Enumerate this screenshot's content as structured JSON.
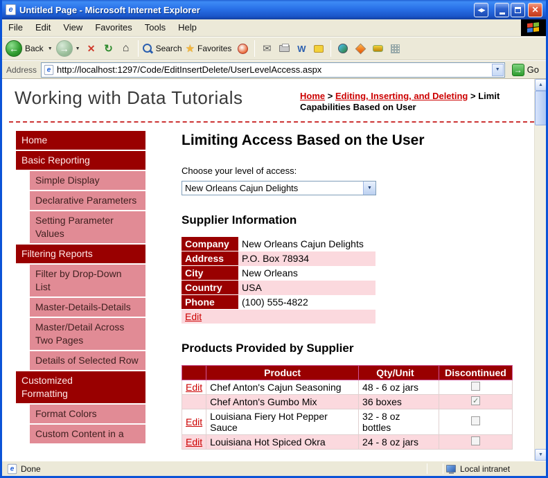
{
  "window": {
    "title": "Untitled Page - Microsoft Internet Explorer"
  },
  "icons": {
    "ie_logo": "e",
    "extra": "◀▶",
    "close": "✕",
    "back": "←",
    "forward": "→",
    "stop": "✕",
    "refresh": "↻",
    "home": "⌂",
    "star": "★",
    "mail": "✉",
    "edit_w": "W",
    "dropdown": "▼",
    "up": "▲",
    "down": "▼",
    "go": "→"
  },
  "menu": {
    "items": [
      "File",
      "Edit",
      "View",
      "Favorites",
      "Tools",
      "Help"
    ]
  },
  "toolbar": {
    "back_label": "Back",
    "search_label": "Search",
    "favorites_label": "Favorites"
  },
  "address": {
    "label": "Address",
    "url": "http://localhost:1297/Code/EditInsertDelete/UserLevelAccess.aspx",
    "go_label": "Go"
  },
  "header": {
    "site_title": "Working with Data Tutorials",
    "breadcrumb": {
      "home": "Home",
      "separator": ">",
      "section": "Editing, Inserting, and Deleting",
      "current": "Limit Capabilities Based on User"
    }
  },
  "sidebar": {
    "items": [
      {
        "label": "Home",
        "type": "main"
      },
      {
        "label": "Basic Reporting",
        "type": "main"
      },
      {
        "label": "Simple Display",
        "type": "sub"
      },
      {
        "label": "Declarative Parameters",
        "type": "sub"
      },
      {
        "label": "Setting Parameter Values",
        "type": "sub"
      },
      {
        "label": "Filtering Reports",
        "type": "main"
      },
      {
        "label": "Filter by Drop-Down List",
        "type": "sub"
      },
      {
        "label": "Master-Details-Details",
        "type": "sub"
      },
      {
        "label": "Master/Detail Across Two Pages",
        "type": "sub"
      },
      {
        "label": "Details of Selected Row",
        "type": "sub"
      },
      {
        "label": "Customized Formatting",
        "type": "main"
      },
      {
        "label": "Format Colors",
        "type": "sub"
      },
      {
        "label": "Custom Content in a",
        "type": "sub"
      }
    ]
  },
  "main": {
    "page_title": "Limiting Access Based on the User",
    "access_label": "Choose your level of access:",
    "access_value": "New Orleans Cajun Delights",
    "supplier": {
      "title": "Supplier Information",
      "rows": [
        {
          "label": "Company",
          "value": "New Orleans Cajun Delights"
        },
        {
          "label": "Address",
          "value": "P.O. Box 78934"
        },
        {
          "label": "City",
          "value": "New Orleans"
        },
        {
          "label": "Country",
          "value": "USA"
        },
        {
          "label": "Phone",
          "value": "(100) 555-4822"
        }
      ],
      "edit_label": "Edit"
    },
    "products": {
      "title": "Products Provided by Supplier",
      "columns": [
        "",
        "Product",
        "Qty/Unit",
        "Discontinued"
      ],
      "rows": [
        {
          "edit": "Edit",
          "product": "Chef Anton's Cajun Seasoning",
          "qty": "48 - 6 oz jars",
          "discontinued": false
        },
        {
          "edit": "",
          "product": "Chef Anton's Gumbo Mix",
          "qty": "36 boxes",
          "discontinued": true
        },
        {
          "edit": "Edit",
          "product": "Louisiana Fiery Hot Pepper Sauce",
          "qty": "32 - 8 oz bottles",
          "discontinued": false
        },
        {
          "edit": "Edit",
          "product": "Louisiana Hot Spiced Okra",
          "qty": "24 - 8 oz jars",
          "discontinued": false
        }
      ]
    }
  },
  "statusbar": {
    "status": "Done",
    "zone": "Local intranet"
  },
  "colors": {
    "maroon": "#990000",
    "sidebar_pink": "#E18B95",
    "row_pink": "#FBD9DE",
    "link_red": "#CC0000",
    "title_blue": "#2A6BE8"
  }
}
